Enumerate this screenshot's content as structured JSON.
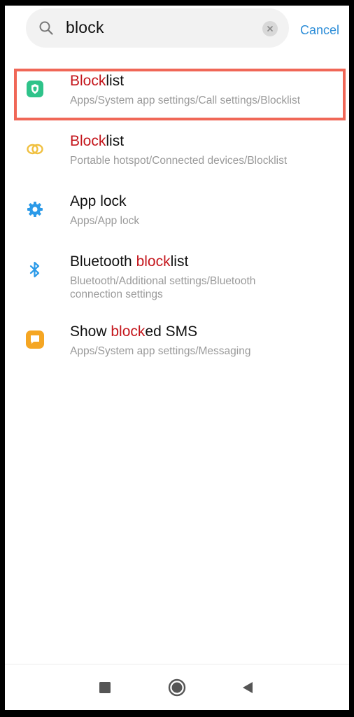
{
  "search": {
    "query": "block",
    "cancel_label": "Cancel"
  },
  "results": [
    {
      "title_highlight": "Block",
      "title_rest": "list",
      "path": "Apps/System app settings/Call settings/Blocklist",
      "icon": "shield-icon",
      "icon_color": "#2ec38a"
    },
    {
      "title_highlight": "Block",
      "title_rest": "list",
      "path": "Portable hotspot/Connected devices/Blocklist",
      "icon": "link-icon",
      "icon_color": "#f0c040"
    },
    {
      "title_plain": "App lock",
      "path": "Apps/App lock",
      "icon": "gear-icon",
      "icon_color": "#2b9ae8"
    },
    {
      "title_before": "Bluetooth ",
      "title_highlight": "block",
      "title_rest": "list",
      "path": "Bluetooth/Additional settings/Bluetooth connection settings",
      "icon": "bluetooth-icon",
      "icon_color": "#2b9ae8"
    },
    {
      "title_before": "Show ",
      "title_highlight": "block",
      "title_rest": "ed SMS",
      "path": "Apps/System app settings/Messaging",
      "icon": "message-icon",
      "icon_color": "#f5a623"
    }
  ],
  "colors": {
    "highlight_text": "#c4161c",
    "selection_border": "#f06757",
    "accent": "#2e8ed8"
  }
}
